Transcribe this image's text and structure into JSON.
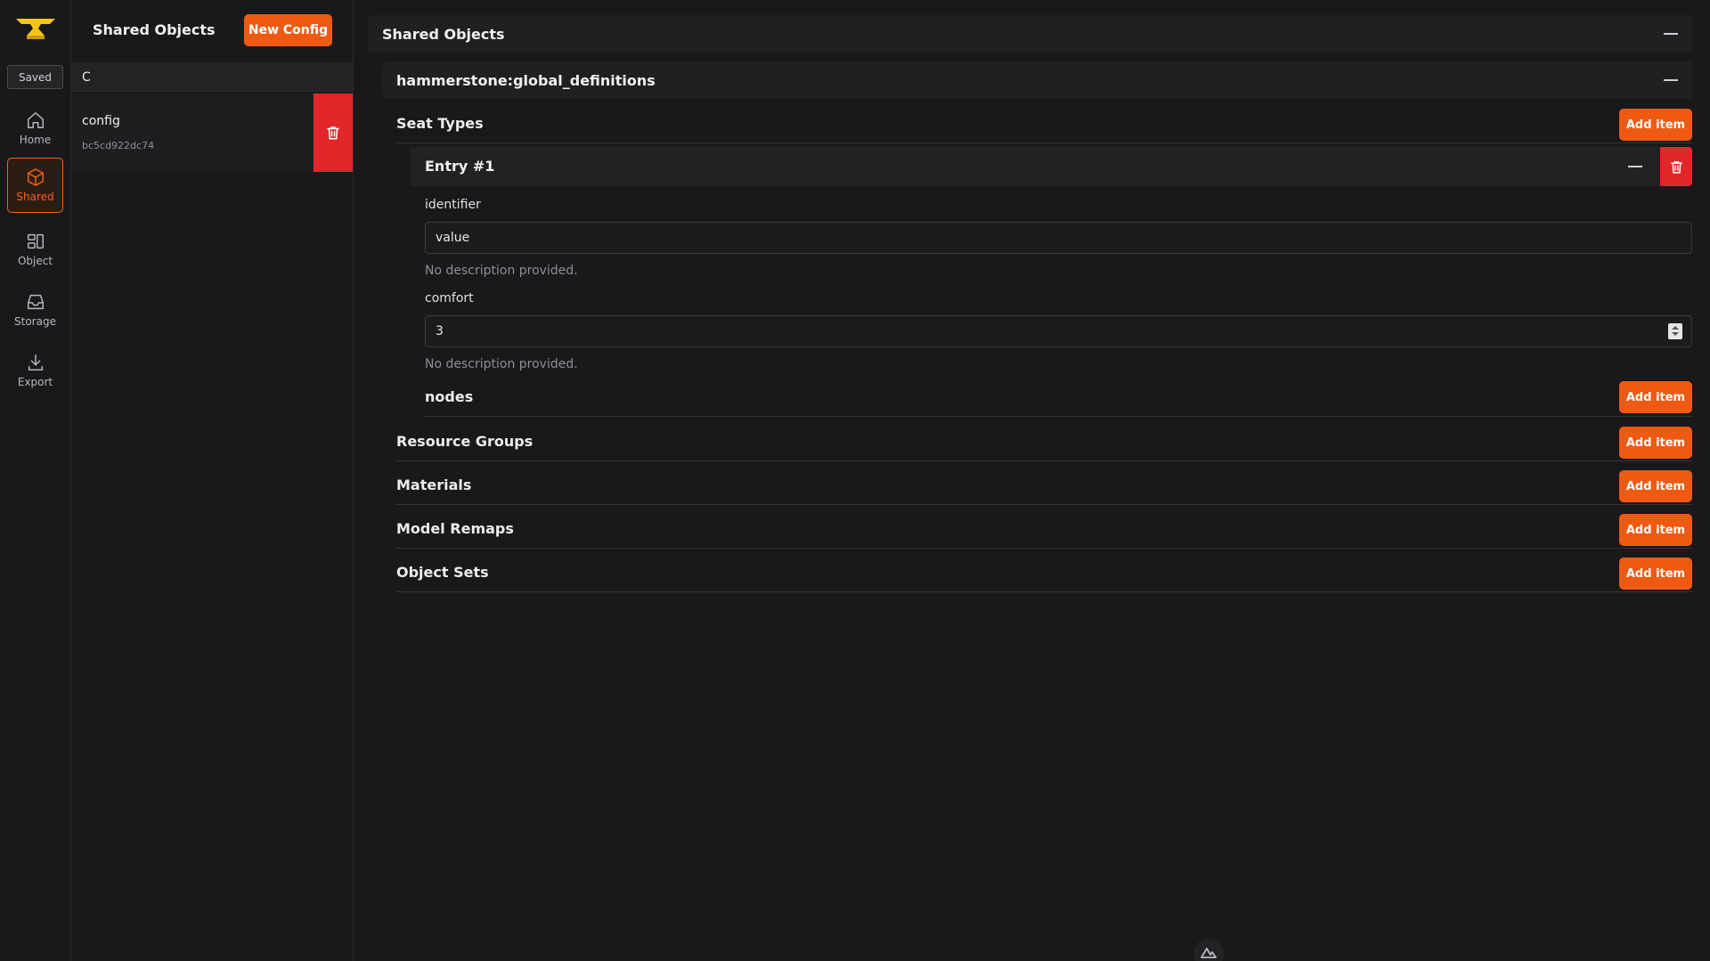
{
  "rail": {
    "saved_label": "Saved",
    "items": [
      {
        "label": "Home",
        "icon": "home-icon"
      },
      {
        "label": "Shared",
        "icon": "cube-icon",
        "active": true
      },
      {
        "label": "Object",
        "icon": "object-icon"
      },
      {
        "label": "Storage",
        "icon": "inbox-icon"
      },
      {
        "label": "Export",
        "icon": "download-icon"
      }
    ]
  },
  "panel": {
    "title": "Shared Objects",
    "new_config_label": "New Config",
    "search_value": "C",
    "configs": [
      {
        "name": "config",
        "hash": "bc5cd922dc74"
      }
    ]
  },
  "main": {
    "section_title": "Shared Objects",
    "definition_title": "hammerstone:global_definitions",
    "add_item_label": "Add item",
    "groups": [
      {
        "title": "Seat Types"
      },
      {
        "title": "Resource Groups"
      },
      {
        "title": "Materials"
      },
      {
        "title": "Model Remaps"
      },
      {
        "title": "Object Sets"
      }
    ],
    "entry": {
      "title": "Entry #1",
      "fields": [
        {
          "label": "identifier",
          "value": "value",
          "description": "No description provided."
        },
        {
          "label": "comfort",
          "value": "3",
          "description": "No description provided."
        }
      ],
      "nodes_title": "nodes"
    }
  },
  "colors": {
    "accent": "#ef5a12",
    "danger": "#e2272b",
    "background": "#19191b"
  }
}
